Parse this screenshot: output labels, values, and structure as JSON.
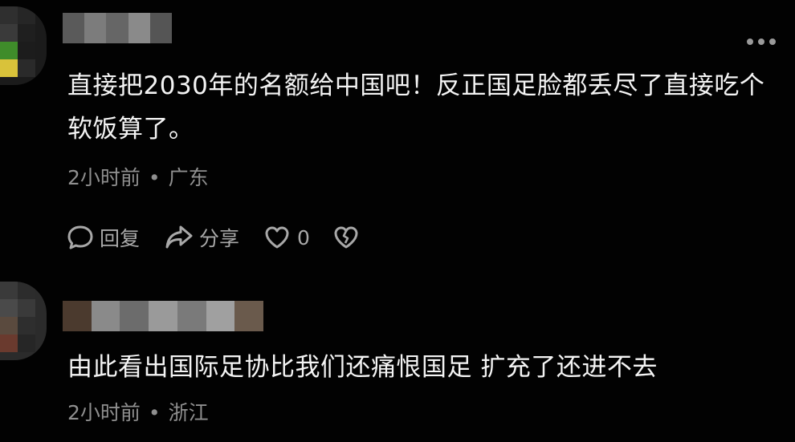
{
  "comments": [
    {
      "text": "直接把2030年的名额给中国吧！反正国足脸都丢尽了直接吃个软饭算了。",
      "time": "2小时前",
      "location": "广东",
      "actions": {
        "reply_label": "回复",
        "share_label": "分享",
        "like_count": "0"
      }
    },
    {
      "text": "由此看出国际足协比我们还痛恨国足  扩充了还进不去",
      "time": "2小时前",
      "location": "浙江"
    }
  ],
  "icons": [
    "more-icon",
    "reply-icon",
    "share-icon",
    "heart-icon",
    "broken-heart-icon"
  ],
  "colors": {
    "background": "#020202",
    "text": "#f4f4f4",
    "meta": "#8f8f8f",
    "icon": "#a8a8a8"
  }
}
